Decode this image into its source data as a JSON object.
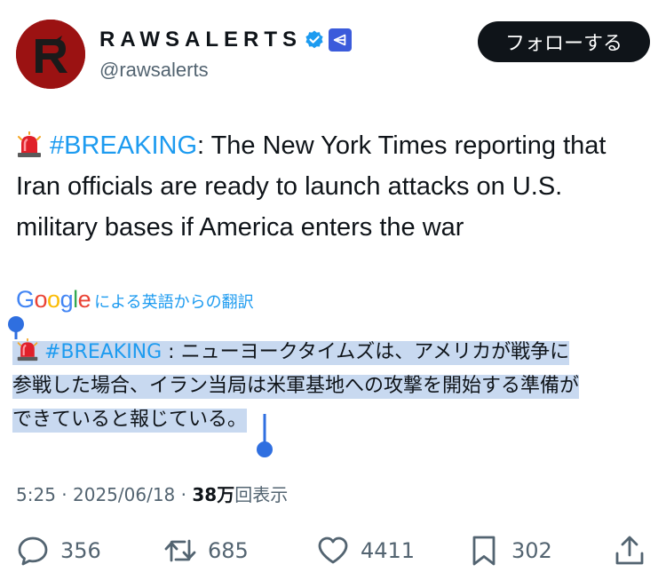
{
  "author": {
    "display_name": "RAWSALERTS",
    "handle": "@rawsalerts"
  },
  "follow_label": "フォローする",
  "tweet": {
    "hashtag": "#BREAKING",
    "text_line1_rest": ": The New York Times reporting that",
    "text_line2": "Iran officials are ready to launch attacks on U.S.",
    "text_line3": "military bases if America enters the war"
  },
  "translation": {
    "provider": "Google",
    "label": "による英語からの翻訳",
    "hashtag": "#BREAKING",
    "line1_rest": " : ニューヨークタイムズは、アメリカが戦争に",
    "line2": "参戦した場合、イラン当局は米軍基地への攻撃を開始する準備が",
    "line3": "できていると報じている。"
  },
  "meta": {
    "time": "5:25",
    "sep1": " · ",
    "date": "2025/06/18",
    "sep2": " · ",
    "views_count": "38万",
    "views_label": "回表示"
  },
  "actions": {
    "replies": "356",
    "reposts": "685",
    "likes": "4411",
    "bookmarks": "302"
  },
  "colors": {
    "accent": "#1d9bf0",
    "selection": "#c8d9f0",
    "avatar_bg": "#9b1212",
    "secondary_text": "#536471"
  }
}
